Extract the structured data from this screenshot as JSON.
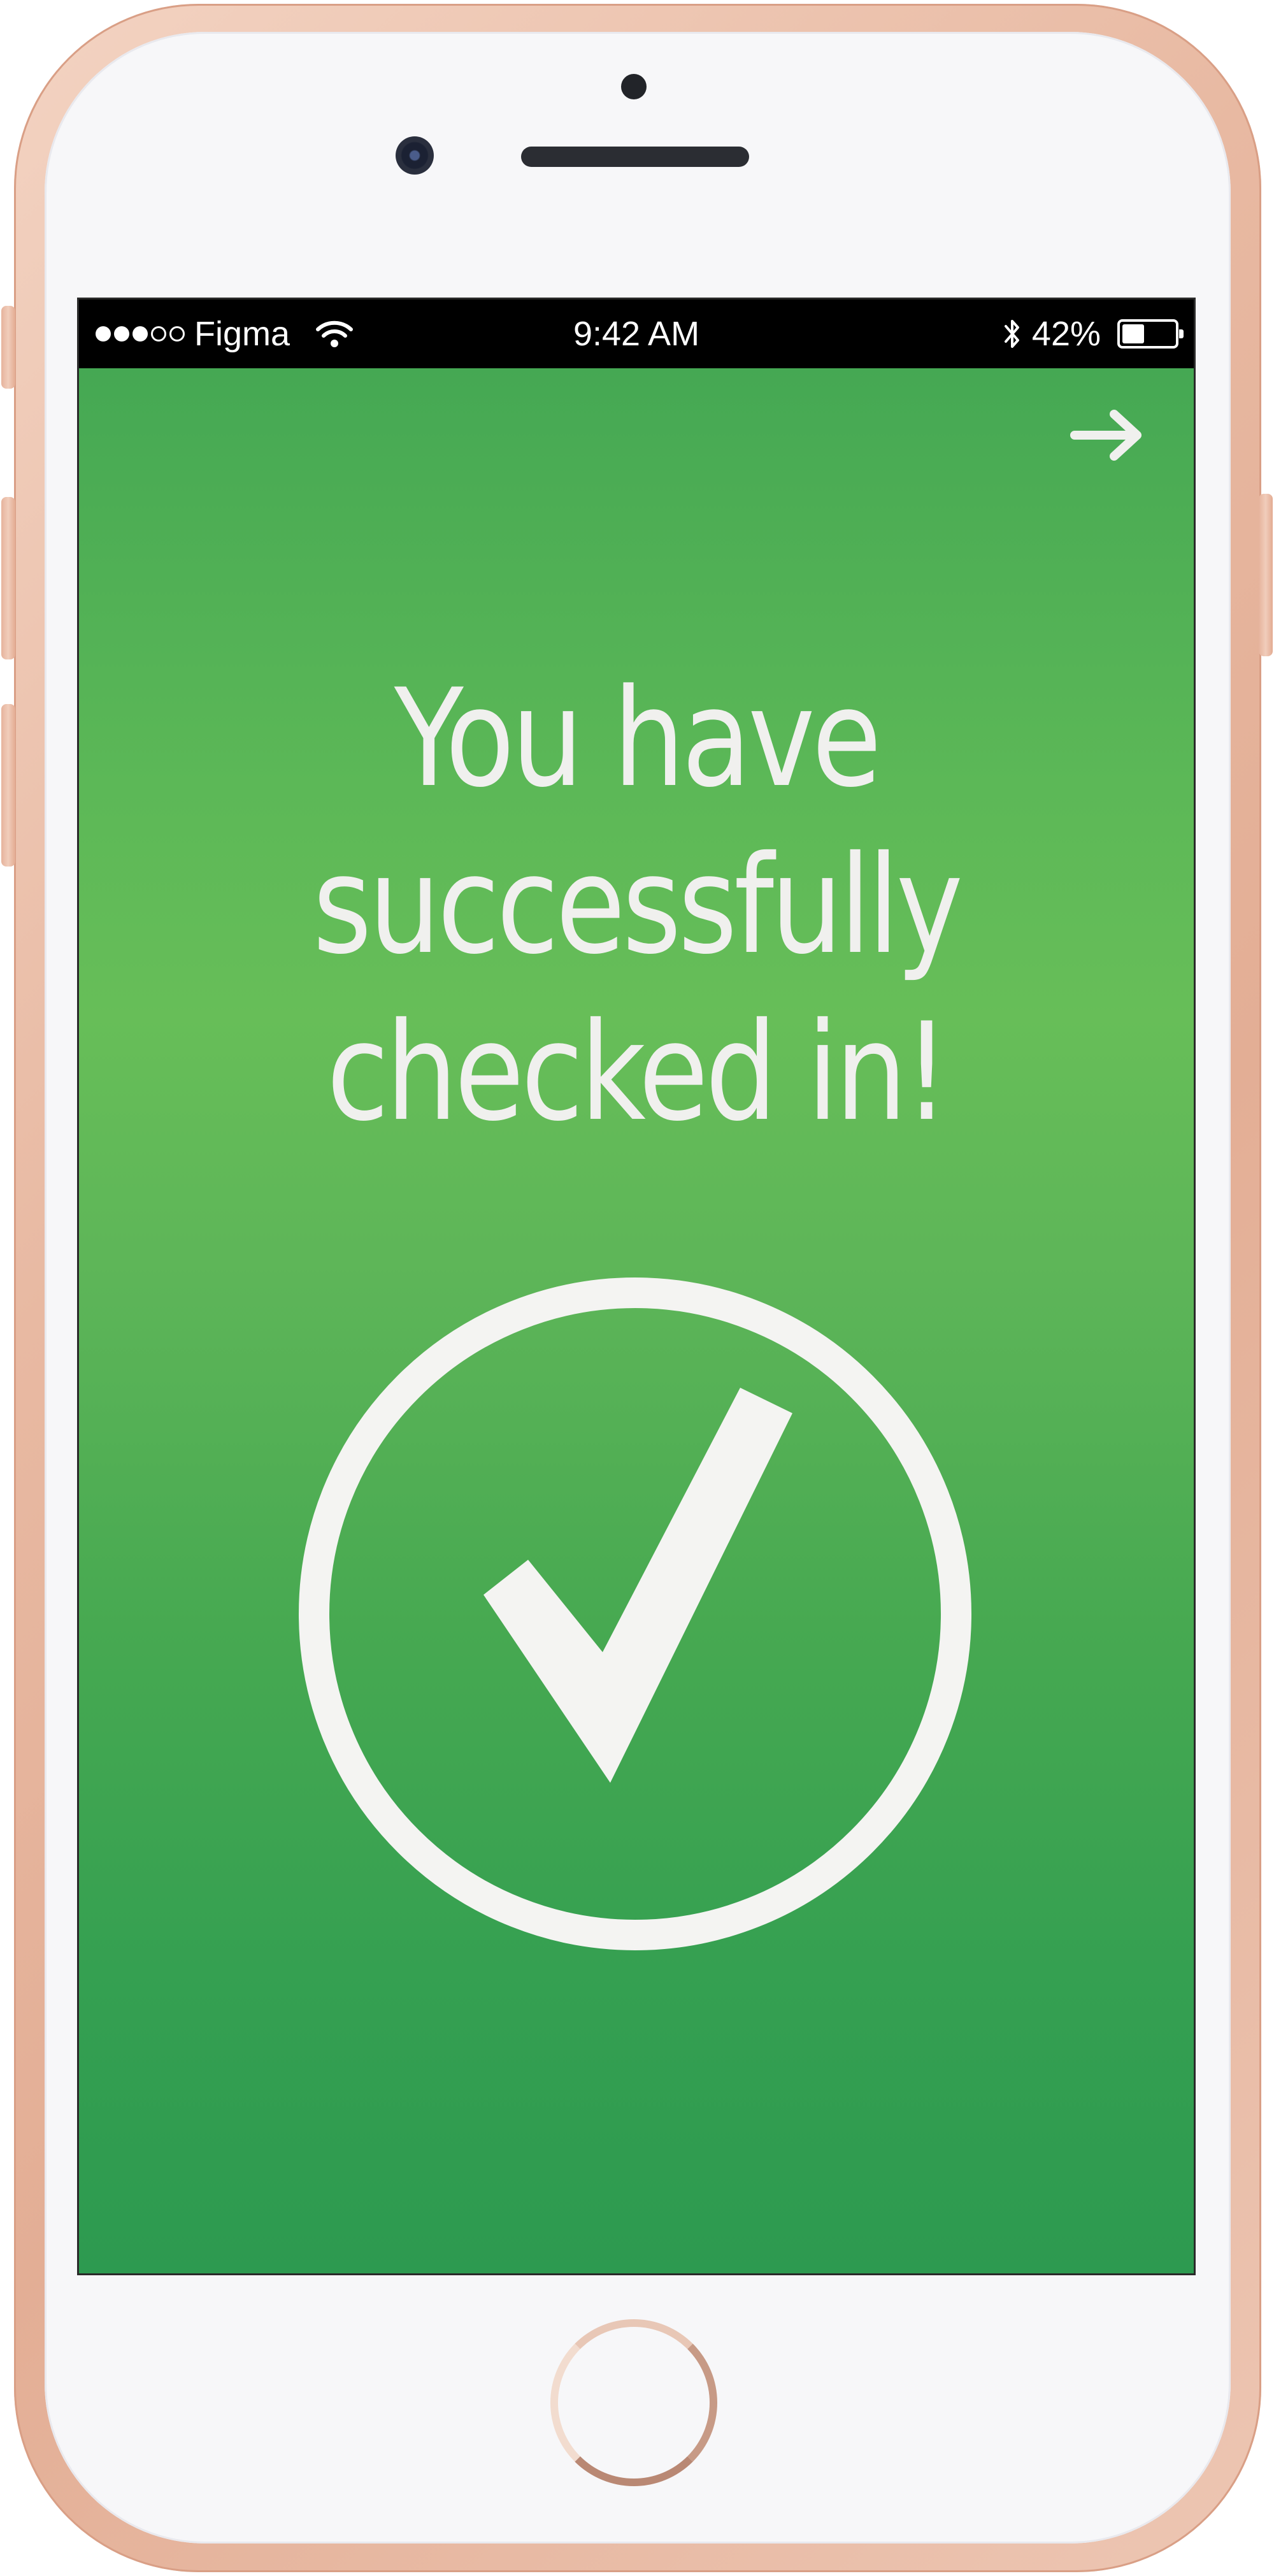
{
  "status_bar": {
    "signal_bars_filled": 3,
    "signal_bars_total": 5,
    "carrier": "Figma",
    "wifi_icon": "wifi-icon",
    "time": "9:42 AM",
    "bluetooth_icon": "bluetooth-icon",
    "battery_percent": "42%",
    "battery_level": 0.42
  },
  "screen": {
    "next_icon": "arrow-right-icon",
    "headline": "You have successfully checked in!",
    "badge_icon": "checkmark-circle-icon"
  },
  "colors": {
    "gradient_top": "#45a853",
    "gradient_mid": "#67be58",
    "gradient_bottom": "#2d9a50",
    "foreground": "#f0f0ee",
    "status_bar_bg": "#000000",
    "phone_frame": "#e8b9a2"
  }
}
